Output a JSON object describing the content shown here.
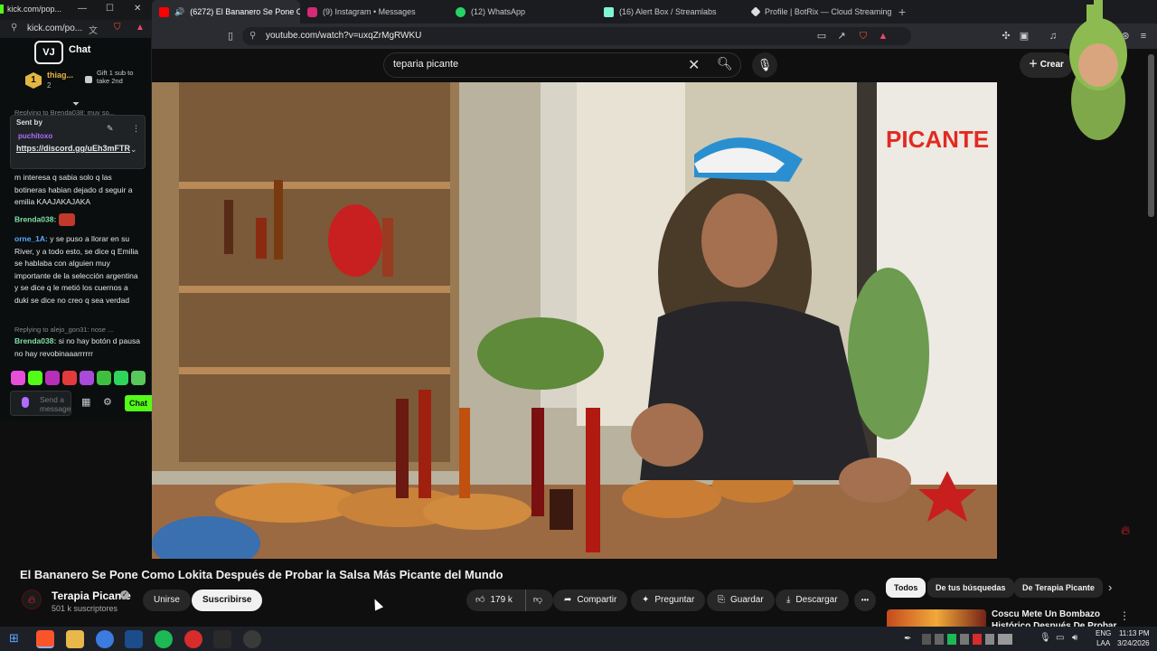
{
  "browser": {
    "tabs": [
      {
        "label": "(6272) El Bananero Se Pone C",
        "fav_color": "#ff0000",
        "active": true
      },
      {
        "label": "(9) Instagram • Messages",
        "fav_color": "#d62976",
        "active": false
      },
      {
        "label": "(12) WhatsApp",
        "fav_color": "#25d366",
        "active": false
      },
      {
        "label": "(16) Alert Box / Streamlabs",
        "fav_color": "#80f5d2",
        "active": false
      },
      {
        "label": "Profile | BotRix — Cloud Streaming B",
        "fav_color": "#dddddd",
        "active": false
      }
    ],
    "url": "youtube.com/watch?v=uxqZrMgRWKU",
    "new_tab": "+",
    "close_glyph": "✕"
  },
  "youtube": {
    "search_query": "teparia picante",
    "create_label": "Crear",
    "video_overlay": "PICANTE",
    "video_title": "El Bananero Se Pone Como Lokita Después de Probar la Salsa Más Picante del Mundo",
    "channel": {
      "name": "Terapia Picante",
      "subs": "501 k suscriptores",
      "verified": "✓"
    },
    "buttons": {
      "join": "Unirse",
      "subscribe": "Suscribirse",
      "likes": "179 k",
      "share": "Compartir",
      "ask": "Preguntar",
      "save": "Guardar",
      "download": "Descargar",
      "more": "•••"
    },
    "chips": [
      "Todos",
      "De tus búsquedas",
      "De Terapia Picante"
    ],
    "recommendation": {
      "title": "Coscu Mete Un Bombazo Histórico Después De Probar"
    }
  },
  "kick": {
    "window_title": "kick.com/pop...",
    "url": "kick.com/po...",
    "chat_header": "Chat",
    "logo_text": "VJ",
    "gifter": {
      "rank": "1",
      "name": "thiag...",
      "count": "2",
      "text": "Gift 1 sub to take 2nd"
    },
    "pinned": {
      "sent_by": "Sent by",
      "user": "puchitoxo",
      "link": "https://discord.gg/uEh3mFTR"
    },
    "reply_top": "Replying to Brenda038: muy so...",
    "messages": [
      {
        "user": "",
        "color": "#ffffff",
        "text": "m interesa q sabia solo q las botineras habian dejado d seguir a emilia KAAJAKAJAKA"
      },
      {
        "user": "Brenda038:",
        "color": "#7fe0a5",
        "text": ""
      },
      {
        "user": "orne_1A:",
        "color": "#5aa9ff",
        "text": "y se puso a llorar en su River, y a todo esto, se dice q Emilia se hablaba con alguien muy importante de la selección argentina y se dice q le metió los cuernos a duki se dice no creo q sea verdad"
      }
    ],
    "reply_bottom": "Replying to alejo_gon31: nose ...",
    "last_message": {
      "user": "Brenda038:",
      "text": "si no hay botón d pausa no hay revobinaaarrrrrr"
    },
    "input_placeholder": "Send a message",
    "chat_button": "Chat"
  },
  "taskbar": {
    "lang_line1": "ENG",
    "lang_line2": "LAA",
    "time": "11:13 PM",
    "date": "3/24/2026"
  }
}
